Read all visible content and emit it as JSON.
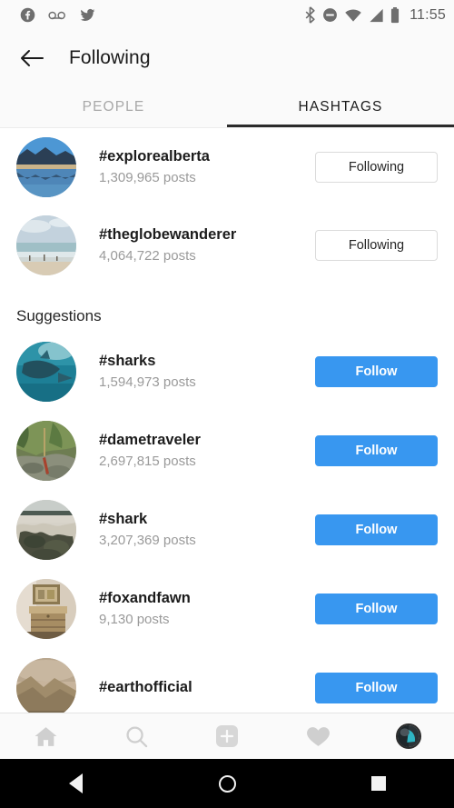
{
  "status_bar": {
    "time": "11:55",
    "left_icons": [
      "facebook-icon",
      "voicemail-icon",
      "twitter-icon"
    ],
    "right_icons": [
      "bluetooth-icon",
      "do-not-disturb-icon",
      "wifi-icon",
      "cellular-signal-icon",
      "battery-icon"
    ]
  },
  "header": {
    "back_label": "back-arrow",
    "title": "Following"
  },
  "tabs": [
    {
      "label": "PEOPLE",
      "active": false
    },
    {
      "label": "HASHTAGS",
      "active": true
    }
  ],
  "following_rows": [
    {
      "tag": "#explorealberta",
      "posts": "1,309,965 posts",
      "button": "Following",
      "avatar": "mountain-lake"
    },
    {
      "tag": "#theglobewanderer",
      "posts": "4,064,722 posts",
      "button": "Following",
      "avatar": "beach"
    }
  ],
  "suggestions_heading": "Suggestions",
  "suggestion_rows": [
    {
      "tag": "#sharks",
      "posts": "1,594,973 posts",
      "button": "Follow",
      "avatar": "underwater-shark"
    },
    {
      "tag": "#dametraveler",
      "posts": "2,697,815 posts",
      "button": "Follow",
      "avatar": "jungle"
    },
    {
      "tag": "#shark",
      "posts": "3,207,369 posts",
      "button": "Follow",
      "avatar": "rocky-shore"
    },
    {
      "tag": "#foxandfawn",
      "posts": "9,130 posts",
      "button": "Follow",
      "avatar": "vintage-interior"
    },
    {
      "tag": "#earthofficial",
      "posts": "",
      "button": "Follow",
      "avatar": "desert-landscape"
    }
  ],
  "bottom_nav": [
    {
      "icon": "home-icon"
    },
    {
      "icon": "search-icon"
    },
    {
      "icon": "add-post-icon"
    },
    {
      "icon": "activity-heart-icon"
    },
    {
      "icon": "profile-avatar"
    }
  ],
  "system_nav": [
    {
      "icon": "android-back-icon"
    },
    {
      "icon": "android-home-icon"
    },
    {
      "icon": "android-recents-icon"
    }
  ],
  "colors": {
    "follow_blue": "#3897f0",
    "background": "#ffffff",
    "chrome": "#fafafa",
    "text_primary": "#262626",
    "text_secondary": "#9a9a9a"
  }
}
